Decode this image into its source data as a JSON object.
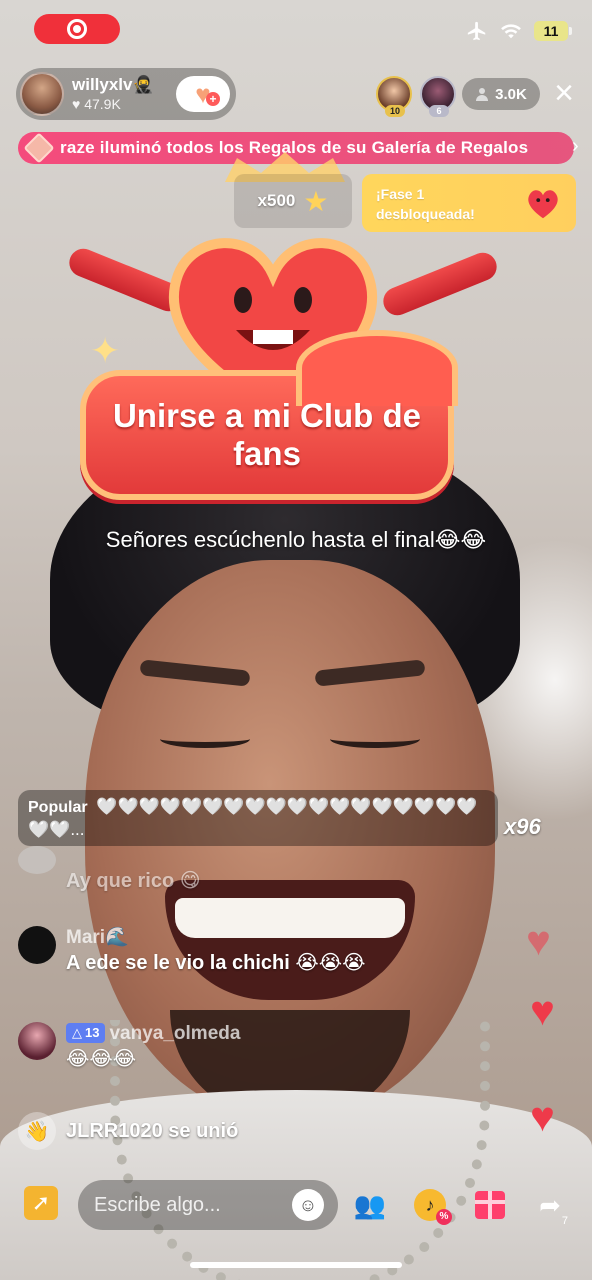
{
  "host": {
    "name": "willyxlv🥷",
    "likes": "47.9K"
  },
  "status": {
    "battery": "11"
  },
  "viewers": {
    "top1_badge": "10",
    "top2_badge": "6",
    "count": "3.0K"
  },
  "banner": {
    "text": "raze iluminó todos los Regalos de su Galería de Regalos"
  },
  "gift_combo": {
    "count": "x500"
  },
  "phase_notice": {
    "line1": "¡Fase 1",
    "line2": "desbloqueada!"
  },
  "fan_club": {
    "line1": "Unirse a mi Club de",
    "line2": "fans"
  },
  "caption": "Señores escúchenlo hasta el final😂😂",
  "popular": {
    "label": "Popular",
    "hearts": "🤍🤍🤍🤍🤍🤍🤍🤍🤍🤍🤍🤍🤍🤍🤍🤍🤍🤍🤍🤍...",
    "multiplier": "x96"
  },
  "chat": [
    {
      "user": "",
      "text": "Ay que rico 😋"
    },
    {
      "user": "Mari🌊",
      "text": "A ede se le vio la chichi 😭😭😭"
    },
    {
      "user": "vanya_olmeda",
      "level": "13",
      "text": "😂😂😂"
    }
  ],
  "join": {
    "text": "JLRR1020 se unió"
  },
  "bottom": {
    "placeholder": "Escribe algo...",
    "share_count": "7"
  },
  "icons": {
    "record": "record-icon",
    "airplane": "airplane-icon",
    "wifi": "wifi-icon",
    "close": "close-icon",
    "viewer": "person-icon",
    "gift": "gift-icon",
    "share": "share-arrow-icon"
  },
  "colors": {
    "record_red": "#f0303a",
    "banner_pink": "#f64478",
    "phase_yellow": "#ffd65c",
    "fanclub_red": "#e23a3a",
    "level_blue": "#5e7ef2",
    "heart_red": "#ee3a4a"
  }
}
